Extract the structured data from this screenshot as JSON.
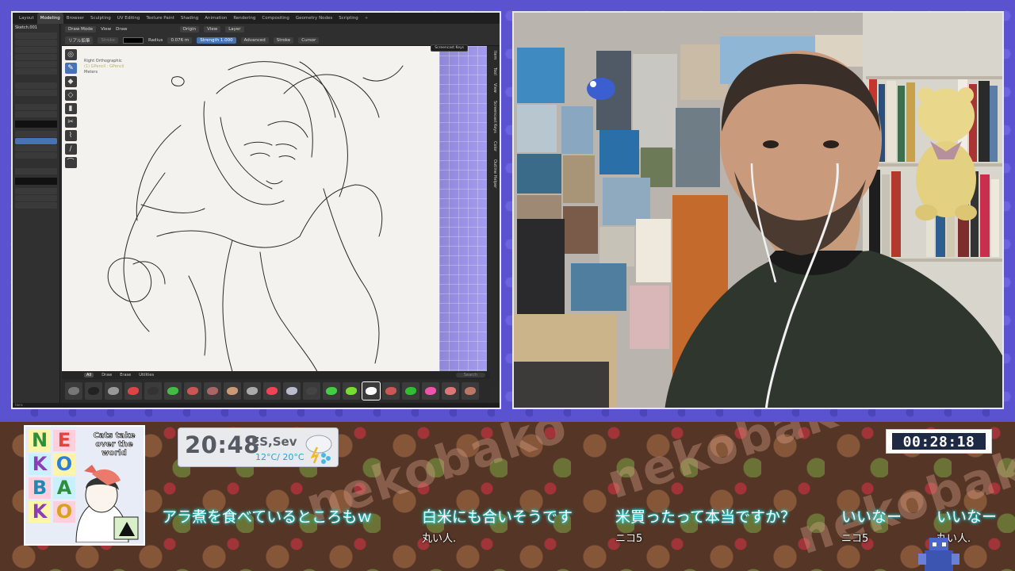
{
  "blender": {
    "workspaces": [
      "Layout",
      "Modeling",
      "Browser",
      "Sculpting",
      "UV Editing",
      "Texture Paint",
      "Shading",
      "Animation",
      "Rendering",
      "Compositing",
      "Geometry Nodes",
      "Scripting",
      "+"
    ],
    "active_workspace": "Modeling",
    "object_name": "Sketch.001",
    "header": {
      "mode": "Draw Mode",
      "menu_view": "View",
      "menu_draw": "Draw",
      "origin": "Origin",
      "view": "View",
      "layer": "Layer",
      "brush_name": "リアル鉛筆",
      "stroke_field": "Stroke",
      "radius_label": "Radius",
      "radius_value": "0.076 m",
      "strength_label": "Strength",
      "strength_value": "1.000",
      "advanced": "Advanced",
      "stroke": "Stroke",
      "cursor": "Cursor",
      "screencast_popup": "Screencast Keys"
    },
    "viewport": {
      "view_name": "Right Orthographic",
      "collection": "(1) GPencil : GPencil",
      "units": "Meters"
    },
    "side_tabs": [
      "Item",
      "Tool",
      "View",
      "Screencast Keys",
      "Color",
      "Outline Helper"
    ],
    "brush_tabs": [
      "All",
      "Draw",
      "Erase",
      "Utilities"
    ],
    "brush_search_placeholder": "Search",
    "brush_colors": [
      "#777",
      "#222",
      "#999",
      "#d44",
      "#333",
      "#4b4",
      "#c55",
      "#a66",
      "#c97",
      "#aaa",
      "#e45",
      "#bbc",
      "#444",
      "#4c4",
      "#7d3",
      "#fff",
      "#c55",
      "#3b3",
      "#e5a",
      "#d77",
      "#b76"
    ],
    "active_brush_index": 15,
    "status_text": "tions"
  },
  "overlay": {
    "logo": {
      "letters": [
        "N",
        "E",
        "K",
        "O",
        "B",
        "A",
        "K",
        "O"
      ],
      "tagline": "Cats take over the world"
    },
    "clock": {
      "time": "20:48",
      "location": "ES,Sev",
      "temps": "12°C/ 20°C",
      "weather_icon": "rain-cloud-icon"
    },
    "timer": "00:28:18",
    "comments": [
      {
        "text": "アラ煮を食べているところもｗ",
        "author": ""
      },
      {
        "text": "白米にも合いそうです",
        "author": "丸い人."
      },
      {
        "text": "米買ったって本当ですか？",
        "author": "ニコ5"
      },
      {
        "text": "いいなー",
        "author": "ニコ5"
      },
      {
        "text": "いいなー",
        "author": "丸い人."
      }
    ],
    "pattern_word": "nekobako"
  }
}
